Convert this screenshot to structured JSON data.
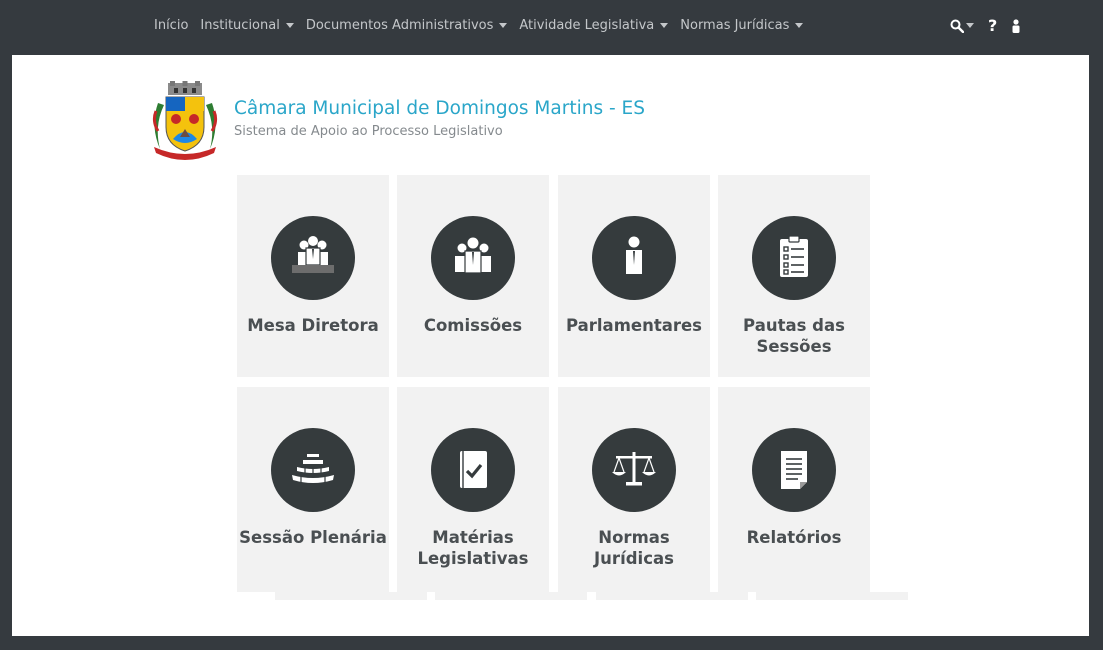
{
  "nav": {
    "items": [
      {
        "label": "Início",
        "dropdown": false
      },
      {
        "label": "Institucional",
        "dropdown": true
      },
      {
        "label": "Documentos Administrativos",
        "dropdown": true
      },
      {
        "label": "Atividade Legislativa",
        "dropdown": true
      },
      {
        "label": "Normas Jurídicas",
        "dropdown": true
      }
    ],
    "help_label": "?",
    "icons": [
      "search-icon",
      "help-icon",
      "user-icon"
    ]
  },
  "header": {
    "title": "Câmara Municipal de Domingos Martins - ES",
    "subtitle": "Sistema de Apoio ao Processo Legislativo",
    "logo": "coat-of-arms"
  },
  "tiles": [
    {
      "label": "Mesa Diretora",
      "icon": "board-icon"
    },
    {
      "label": "Comissões",
      "icon": "committee-icon"
    },
    {
      "label": "Parlamentares",
      "icon": "parliamentarian-icon"
    },
    {
      "label": "Pautas das Sessões",
      "icon": "clipboard-checklist-icon"
    },
    {
      "label": "Sessão Plenária",
      "icon": "plenary-icon"
    },
    {
      "label": "Matérias Legislativas",
      "icon": "legislative-matter-icon"
    },
    {
      "label": "Normas Jurídicas",
      "icon": "scales-icon"
    },
    {
      "label": "Relatórios",
      "icon": "report-icon"
    }
  ],
  "colors": {
    "navbar": "#353a3f",
    "title": "#2aa6c9",
    "tile_bg": "#f2f2f2",
    "icon_circle": "#353b3d"
  }
}
